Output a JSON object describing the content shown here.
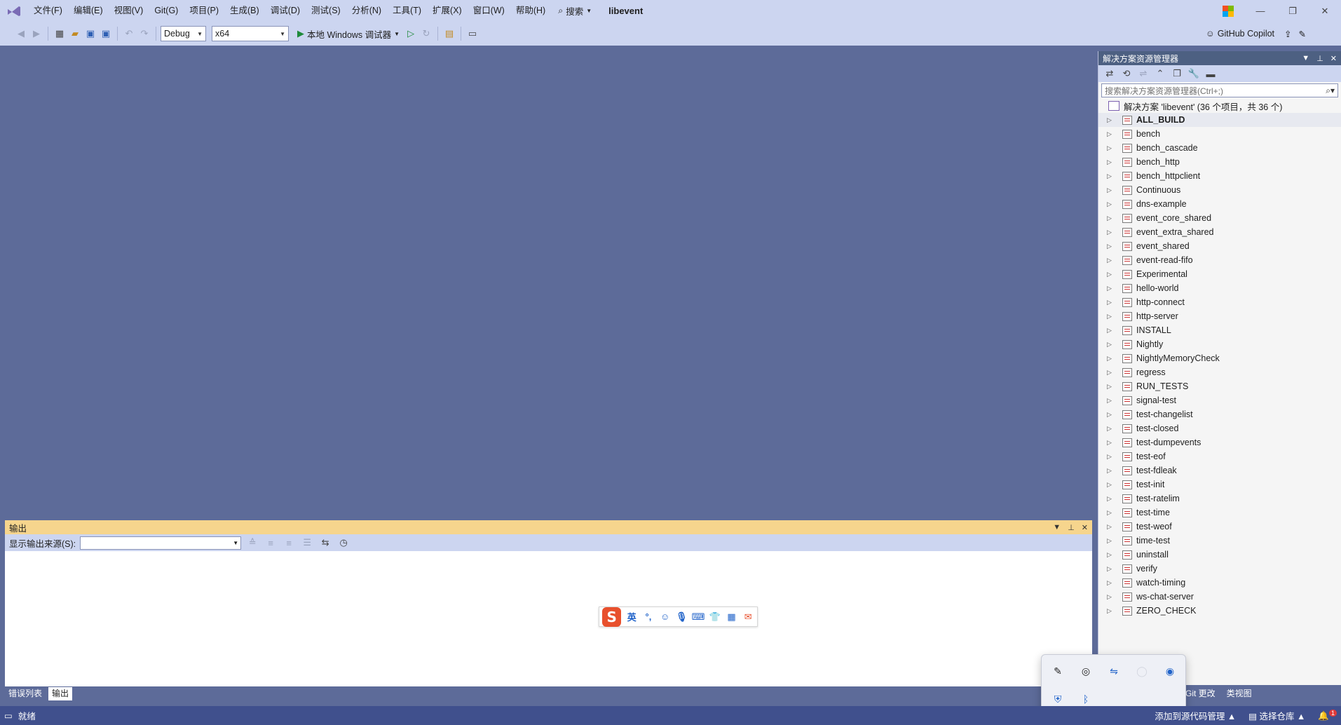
{
  "menu": {
    "items": [
      "文件(F)",
      "编辑(E)",
      "视图(V)",
      "Git(G)",
      "项目(P)",
      "生成(B)",
      "调试(D)",
      "测试(S)",
      "分析(N)",
      "工具(T)",
      "扩展(X)",
      "窗口(W)",
      "帮助(H)"
    ],
    "search_label": "搜索",
    "solution_title": "libevent"
  },
  "toolbar": {
    "config": "Debug",
    "platform": "x64",
    "run_label": "本地 Windows 调试器",
    "copilot_label": "GitHub Copilot"
  },
  "solution_explorer": {
    "title": "解决方案资源管理器",
    "search_placeholder": "搜索解决方案资源管理器(Ctrl+;)",
    "root_label": "解决方案 'libevent' (36 个项目，共 36 个)",
    "projects": [
      "ALL_BUILD",
      "bench",
      "bench_cascade",
      "bench_http",
      "bench_httpclient",
      "Continuous",
      "dns-example",
      "event_core_shared",
      "event_extra_shared",
      "event_shared",
      "event-read-fifo",
      "Experimental",
      "hello-world",
      "http-connect",
      "http-server",
      "INSTALL",
      "Nightly",
      "NightlyMemoryCheck",
      "regress",
      "RUN_TESTS",
      "signal-test",
      "test-changelist",
      "test-closed",
      "test-dumpevents",
      "test-eof",
      "test-fdleak",
      "test-init",
      "test-ratelim",
      "test-time",
      "test-weof",
      "time-test",
      "uninstall",
      "verify",
      "watch-timing",
      "ws-chat-server",
      "ZERO_CHECK"
    ]
  },
  "output": {
    "title": "输出",
    "source_label": "显示输出来源(S):",
    "source_value": ""
  },
  "bottom_tabs": {
    "error_list": "错误列表",
    "output": "输出",
    "git_changes": "Git 更改",
    "class_view": "类视图"
  },
  "statusbar": {
    "ready": "就绪",
    "add_source_control": "添加到源代码管理",
    "select_repo": "选择仓库",
    "notification_count": "1"
  },
  "ime": {
    "mode": "英"
  },
  "colors": {
    "accent": "#40508d",
    "editor_bg": "#5d6b99",
    "output_header": "#f6d58d",
    "toolbar_bg": "#ccd5f0"
  }
}
